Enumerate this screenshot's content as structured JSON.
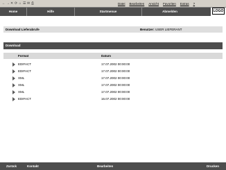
{
  "browser": {
    "nav_icons": [
      "←",
      "→",
      "✕",
      "⟳",
      "⌂",
      "☰",
      "✉",
      "⎙"
    ],
    "menu": [
      "Datei",
      "Bearbeiten",
      "Ansicht",
      "Favoriten",
      "Extras",
      "?"
    ]
  },
  "logo": "LOGO",
  "top_nav": [
    "Home",
    "Hilfe",
    "Startmenue",
    "Abmelden"
  ],
  "info_bar": {
    "title": "Download Lieferabrufe",
    "user_label": "Benutzer:",
    "user_value": "USER LIEFERANT"
  },
  "section": {
    "title": "Download"
  },
  "table": {
    "columns": [
      "Format",
      "Datum"
    ],
    "rows": [
      {
        "format": "EDIFACT",
        "date": "17.07.2002 00:00:00"
      },
      {
        "format": "EDIFACT",
        "date": "17.07.2002 00:00:00"
      },
      {
        "format": "XML",
        "date": "17.07.2002 00:00:00"
      },
      {
        "format": "XML",
        "date": "17.07.2002 00:00:00"
      },
      {
        "format": "XML",
        "date": "17.07.2002 00:00:00"
      },
      {
        "format": "EDIFACT",
        "date": "16.07.2002 00:00:00"
      }
    ]
  },
  "bottom_nav": {
    "back": "Zurück",
    "contact": "Kontakt",
    "edit": "Bearbeiten",
    "print": "Drucken"
  }
}
